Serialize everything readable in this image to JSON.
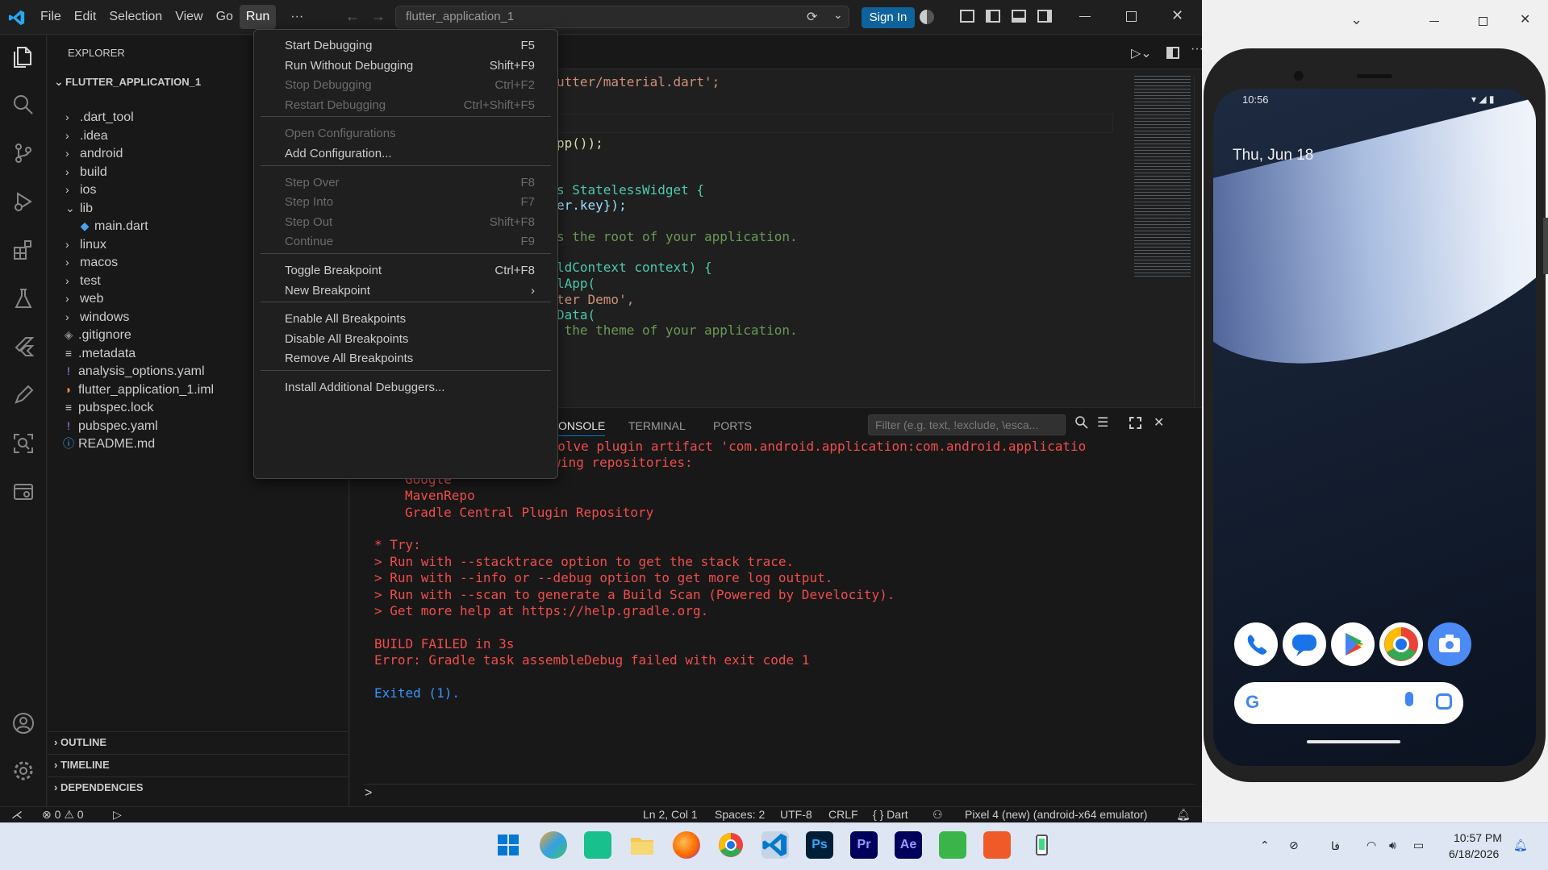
{
  "window": {
    "menus": [
      "File",
      "Edit",
      "Selection",
      "View",
      "Go",
      "Run"
    ],
    "more": "···",
    "command_center": "flutter_application_1",
    "sign_in": "Sign In"
  },
  "explorer": {
    "title": "EXPLORER",
    "root": "FLUTTER_APPLICATION_1",
    "items": [
      {
        "label": ".dart_tool",
        "kind": "folder"
      },
      {
        "label": ".idea",
        "kind": "folder"
      },
      {
        "label": "android",
        "kind": "folder"
      },
      {
        "label": "build",
        "kind": "folder"
      },
      {
        "label": "ios",
        "kind": "folder"
      },
      {
        "label": "lib",
        "kind": "folder-open"
      },
      {
        "label": "main.dart",
        "kind": "dart"
      },
      {
        "label": "linux",
        "kind": "folder"
      },
      {
        "label": "macos",
        "kind": "folder"
      },
      {
        "label": "test",
        "kind": "folder"
      },
      {
        "label": "web",
        "kind": "folder"
      },
      {
        "label": "windows",
        "kind": "folder"
      },
      {
        "label": ".gitignore",
        "kind": "git"
      },
      {
        "label": ".metadata",
        "kind": "lines"
      },
      {
        "label": "analysis_options.yaml",
        "kind": "yaml"
      },
      {
        "label": "flutter_application_1.iml",
        "kind": "rss"
      },
      {
        "label": "pubspec.lock",
        "kind": "lines"
      },
      {
        "label": "pubspec.yaml",
        "kind": "yaml"
      },
      {
        "label": "README.md",
        "kind": "info"
      }
    ],
    "sections": [
      "OUTLINE",
      "TIMELINE",
      "DEPENDENCIES"
    ]
  },
  "run_menu": {
    "groups": [
      [
        {
          "label": "Start Debugging",
          "key": "F5",
          "enabled": true
        },
        {
          "label": "Run Without Debugging",
          "key": "Shift+F9",
          "enabled": true
        },
        {
          "label": "Stop Debugging",
          "key": "Ctrl+F2",
          "enabled": false
        },
        {
          "label": "Restart Debugging",
          "key": "Ctrl+Shift+F5",
          "enabled": false
        }
      ],
      [
        {
          "label": "Open Configurations",
          "key": "",
          "enabled": false
        },
        {
          "label": "Add Configuration...",
          "key": "",
          "enabled": true
        }
      ],
      [
        {
          "label": "Step Over",
          "key": "F8",
          "enabled": false
        },
        {
          "label": "Step Into",
          "key": "F7",
          "enabled": false
        },
        {
          "label": "Step Out",
          "key": "Shift+F8",
          "enabled": false
        },
        {
          "label": "Continue",
          "key": "F9",
          "enabled": false
        }
      ],
      [
        {
          "label": "Toggle Breakpoint",
          "key": "Ctrl+F8",
          "enabled": true
        },
        {
          "label": "New Breakpoint",
          "key": "›",
          "enabled": true
        }
      ],
      [
        {
          "label": "Enable All Breakpoints",
          "key": "",
          "enabled": true
        },
        {
          "label": "Disable All Breakpoints",
          "key": "",
          "enabled": true
        },
        {
          "label": "Remove All Breakpoints",
          "key": "",
          "enabled": true
        }
      ],
      [
        {
          "label": "Install Additional Debuggers...",
          "key": "",
          "enabled": true
        }
      ]
    ]
  },
  "editor": {
    "lines": [
      {
        "text": "utter/material.dart';",
        "color": "#ce9178"
      },
      {
        "text": "pp());",
        "color": "#dcdcaa"
      },
      {
        "text": "s StatelessWidget {",
        "color": "#4ec9b0"
      },
      {
        "text": "er.key});",
        "color": "#9cdcfe"
      },
      {
        "text": "s the root of your application.",
        "color": "#6a9955"
      },
      {
        "text": "ldContext context) {",
        "color": "#4ec9b0"
      },
      {
        "text": "lApp(",
        "color": "#4ec9b0"
      },
      {
        "text": "ter Demo',",
        "color": "#ce9178"
      },
      {
        "text": "Data(",
        "color": "#4ec9b0"
      },
      {
        "text": " the theme of your application.",
        "color": "#6a9955"
      }
    ]
  },
  "panel": {
    "tabs": [
      "ONSOLE",
      "TERMINAL",
      "PORTS"
    ],
    "filter_placeholder": "Filter (e.g. text, !exclude, \\esca...",
    "output": [
      {
        "text": "could not resolve plugin artifact 'com.android.application:com.android.applicatio",
        "color": "#f14c4c",
        "indent": 185
      },
      {
        "text": "Searched in the following repositories:",
        "color": "#f14c4c",
        "indent": 53
      },
      {
        "text": "Google",
        "color": "#f14c4c",
        "indent": 72
      },
      {
        "text": "MavenRepo",
        "color": "#f14c4c",
        "indent": 72
      },
      {
        "text": "Gradle Central Plugin Repository",
        "color": "#f14c4c",
        "indent": 72
      },
      {
        "text": "",
        "color": "#f14c4c",
        "indent": 0
      },
      {
        "text": "* Try:",
        "color": "#f14c4c",
        "indent": 34
      },
      {
        "text": "> Run with --stacktrace option to get the stack trace.",
        "color": "#f14c4c",
        "indent": 34
      },
      {
        "text": "> Run with --info or --debug option to get more log output.",
        "color": "#f14c4c",
        "indent": 34
      },
      {
        "text": "> Run with --scan to generate a Build Scan (Powered by Develocity).",
        "color": "#f14c4c",
        "indent": 34
      },
      {
        "text": "> Get more help at https://help.gradle.org.",
        "color": "#f14c4c",
        "indent": 34
      },
      {
        "text": "",
        "color": "#f14c4c",
        "indent": 0
      },
      {
        "text": "BUILD FAILED in 3s",
        "color": "#f14c4c",
        "indent": 34
      },
      {
        "text": "Error: Gradle task assembleDebug failed with exit code 1",
        "color": "#f14c4c",
        "indent": 34
      },
      {
        "text": "",
        "color": "#f14c4c",
        "indent": 0
      },
      {
        "text": "Exited (1).",
        "color": "#3794ff",
        "indent": 34
      }
    ],
    "prompt": ">"
  },
  "status": {
    "errors": "0",
    "warnings": "0",
    "position": "Ln 2, Col 1",
    "spaces": "Spaces: 2",
    "encoding": "UTF-8",
    "eol": "CRLF",
    "language": "Dart",
    "language_icon": "{ }",
    "device": "Pixel 4 (new) (android-x64 emulator)"
  },
  "phone": {
    "time": "10:56",
    "date": "Thu, Jun 18"
  },
  "taskbar": {
    "time": "10:57 PM",
    "date": "6/18/2026",
    "lang": "فا"
  },
  "colors": {
    "accent": "#0e639c",
    "error": "#f14c4c",
    "link": "#3794ff"
  }
}
